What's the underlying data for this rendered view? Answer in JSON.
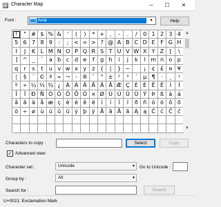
{
  "window": {
    "title": "Character Map",
    "minimize_icon": "minimize-icon",
    "maximize_icon": "maximize-icon",
    "close_icon": "close-icon"
  },
  "font": {
    "label": "Font :",
    "value": "Arial",
    "truetype_glyph": "TT",
    "help_label": "Help"
  },
  "grid": {
    "selected_index": 0,
    "chars": [
      "!",
      "\"",
      "#",
      "$",
      "%",
      "&",
      "'",
      "(",
      ")",
      "*",
      "+",
      ",",
      "-",
      ".",
      "/",
      "0",
      "1",
      "2",
      "3",
      "4",
      "5",
      "6",
      "7",
      "8",
      "9",
      ":",
      ";",
      "<",
      "=",
      ">",
      "?",
      "@",
      "A",
      "B",
      "C",
      "D",
      "E",
      "F",
      "G",
      "H",
      "I",
      "J",
      "K",
      "L",
      "M",
      "N",
      "O",
      "P",
      "Q",
      "R",
      "S",
      "T",
      "U",
      "V",
      "W",
      "X",
      "Y",
      "Z",
      "[",
      "\\",
      "]",
      "^",
      "_",
      "`",
      "a",
      "b",
      "c",
      "d",
      "e",
      "f",
      "g",
      "h",
      "i",
      "j",
      "k",
      "l",
      "m",
      "n",
      "o",
      "p",
      "q",
      "r",
      "s",
      "t",
      "u",
      "v",
      "w",
      "x",
      "y",
      "z",
      "{",
      "|",
      "}",
      "~",
      " ",
      "¡",
      "¢",
      "£",
      "¤",
      "¥",
      "¦",
      "§",
      "¨",
      "©",
      "ª",
      "«",
      "¬",
      "-",
      "®",
      "¯",
      "°",
      "±",
      "²",
      "³",
      "´",
      "µ",
      "¶",
      "·",
      "¸",
      "¹",
      "º",
      "»",
      "¼",
      "½",
      "¾",
      "¿",
      "À",
      "Á",
      "Â",
      "Ã",
      "Ä",
      "Å",
      "Æ",
      "Ç",
      "È",
      "É",
      "Ê",
      "Ë",
      "Ì",
      "Í",
      "Î",
      "Ï",
      "Ð",
      "Ñ",
      "Ò",
      "Ó",
      "Ô",
      "Õ",
      "Ö",
      "×",
      "Ø",
      "Ù",
      "Ú",
      "Û",
      "Ü",
      "Ý",
      "Þ",
      "ß",
      "à",
      "á",
      "â",
      "ã",
      "ä",
      "å",
      "æ",
      "ç",
      "è",
      "é",
      "ê",
      "ë",
      "ì",
      "í",
      "î",
      "ï",
      "ð",
      "ñ",
      "ò",
      "ó",
      "ô",
      "õ",
      "ö",
      "÷",
      "ø",
      "ù",
      "ú",
      "û",
      "ü",
      "ý",
      "þ",
      "ÿ",
      "Ā",
      "ā",
      "Ă",
      "ă",
      "Ą",
      "ą",
      "Ć",
      "ć",
      "Ĉ",
      "ĉ"
    ]
  },
  "copy": {
    "label": "Characters to copy :",
    "value": "",
    "select_label": "Select",
    "copy_label": "Copy"
  },
  "advanced": {
    "label": "Advanced view",
    "checked_mark": "✓"
  },
  "charset": {
    "label": "Character set :",
    "value": "Unicode",
    "goto_label": "Go to Unicode :",
    "goto_value": ""
  },
  "groupby": {
    "label": "Group by :",
    "value": "All"
  },
  "search": {
    "label": "Search for :",
    "value": "",
    "button_label": "Search"
  },
  "status": {
    "text": "U+0021: Exclamation Mark"
  }
}
